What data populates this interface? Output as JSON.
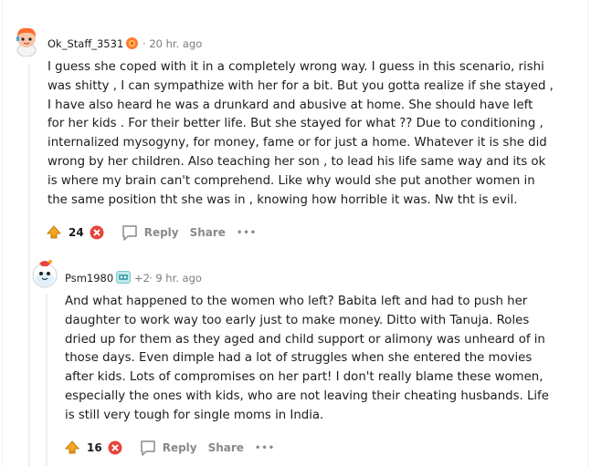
{
  "comments": [
    {
      "username": "Ok_Staff_3531",
      "time": "20 hr. ago",
      "body": [
        "I guess she coped with it in a completely wrong way. I guess in this scenario, rishi",
        "was shitty , I can sympathize with her for a bit. But you gotta realize if she stayed ,",
        "I have also heard he was a drunkard and abusive at home. She should have left",
        "for her kids . For their better life. But she stayed for what ?? Due to conditioning ,",
        "internalized mysogyny, for money, fame or for just a home. Whatever it is she did",
        "wrong by her children. Also teaching her son , to lead his life same way and its ok",
        "is where my brain can't comprehend. Like why would she put another women in",
        "the same position tht she was in , knowing how horrible it was. Nw tht is evil."
      ],
      "votes": "24",
      "reply_label": "Reply",
      "share_label": "Share",
      "more_label": "•••"
    },
    {
      "username": "Psm1980",
      "flair_extra": "+2",
      "time": "9 hr. ago",
      "body": [
        "And what happened to the women who left? Babita left and had to push her",
        "daughter to work way too early just to make money. Ditto with Tanuja. Roles",
        "dried up for them as they aged and child support or alimony was unheard of in",
        "those days. Even dimple had a lot of struggles when she entered the movies",
        "after kids. Lots of compromises on her part! I don't really blame these women,",
        "especially the ones with kids, who are not leaving their cheating husbands. Life",
        "is still very tough for single moms in India."
      ],
      "votes": "16",
      "reply_label": "Reply",
      "share_label": "Share",
      "more_label": "•••"
    }
  ],
  "colors": {
    "upvote_award": "#f5a623",
    "downvote_badge": "#e8443a",
    "meta_gray": "#7c7c7c",
    "action_gray": "#878a8c"
  },
  "icons": [
    "upvote-icon",
    "downvote-icon",
    "comment-icon",
    "more-icon",
    "award-icon"
  ]
}
